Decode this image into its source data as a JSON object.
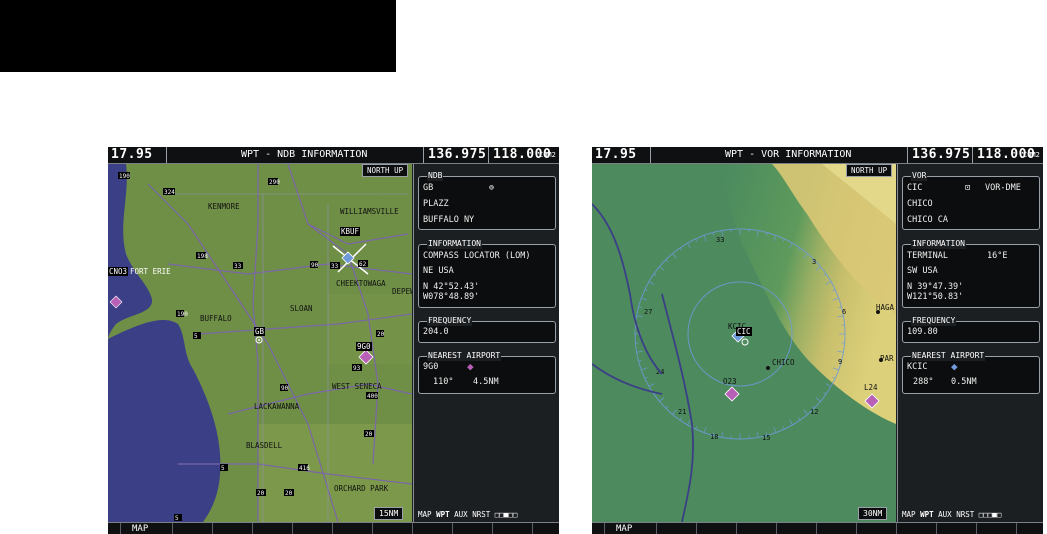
{
  "left_screen": {
    "topbar": {
      "nav_freq": "17.95",
      "page_title": "WPT - NDB INFORMATION",
      "com_standby": "136.975",
      "com_active": "118.000",
      "com_label": "COM2"
    },
    "map": {
      "orientation": "NORTH UP",
      "range": "15NM",
      "labels": [
        "KENMORE",
        "WILLIAMSVILLE",
        "KBUF",
        "SLOAN",
        "CHEEKTOWAGA",
        "DEPEW",
        "BUFFALO",
        "FORT ERIE",
        "WEST SENECA",
        "LACKAWANNA",
        "BLASDELL",
        "ORCHARD PARK",
        "9G0",
        "GB",
        "CNO3"
      ]
    },
    "ndb": {
      "title": "NDB",
      "ident": "GB",
      "name": "PLAZZ",
      "city": "BUFFALO NY"
    },
    "information": {
      "title": "INFORMATION",
      "type": "COMPASS LOCATOR (LOM)",
      "region": "NE USA",
      "lat": "N 42°52.43'",
      "lon": "W078°48.89'"
    },
    "frequency": {
      "title": "FREQUENCY",
      "value": "204.0"
    },
    "nearest_airport": {
      "title": "NEAREST AIRPORT",
      "ident": "9G0",
      "bearing": "110°",
      "distance": "4.5NM"
    },
    "page_group": {
      "map": "MAP",
      "wpt": "WPT",
      "aux": "AUX",
      "nrst": "NRST"
    },
    "softkey": "MAP"
  },
  "right_screen": {
    "topbar": {
      "nav_freq": "17.95",
      "page_title": "WPT - VOR INFORMATION",
      "com_standby": "136.975",
      "com_active": "118.000",
      "com_label": "COM2"
    },
    "map": {
      "orientation": "NORTH UP",
      "range": "30NM",
      "labels": [
        "KCIC",
        "CIC",
        "CHICO",
        "O23",
        "L24",
        "HAGA",
        "PAR"
      ]
    },
    "vor": {
      "title": "VOR",
      "ident": "CIC",
      "type": "VOR-DME",
      "name": "CHICO",
      "city": "CHICO CA"
    },
    "information": {
      "title": "INFORMATION",
      "class": "TERMINAL",
      "declination": "16°E",
      "region": "SW USA",
      "lat": "N 39°47.39'",
      "lon": "W121°50.83'"
    },
    "frequency": {
      "title": "FREQUENCY",
      "value": "109.80"
    },
    "nearest_airport": {
      "title": "NEAREST AIRPORT",
      "ident": "KCIC",
      "bearing": "288°",
      "distance": "0.5NM"
    },
    "page_group": {
      "map": "MAP",
      "wpt": "WPT",
      "aux": "AUX",
      "nrst": "NRST"
    },
    "softkey": "MAP"
  },
  "colors": {
    "land": "#6f8f47",
    "water": "#3b3f86",
    "terrain_low": "#4f8a5c",
    "terrain_high": "#d8c471",
    "panel_bg": "#1c1f22",
    "airport_magenta": "#b860b8",
    "vor_blue": "#6f9ad8"
  }
}
